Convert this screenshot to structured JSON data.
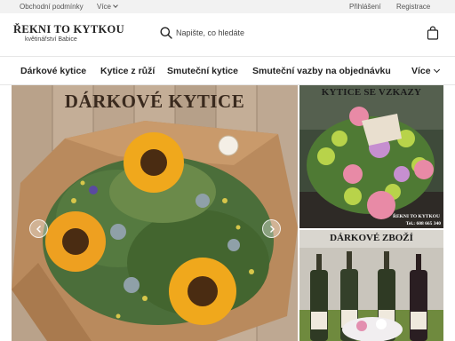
{
  "topbar": {
    "terms_label": "Obchodní podmínky",
    "more_label": "Více",
    "login_label": "Přihlášení",
    "register_label": "Registrace"
  },
  "header": {
    "logo_title": "ŘEKNI TO KYTKOU",
    "logo_subtitle": "květinářství Babice",
    "search_placeholder": "Napište, co hledáte"
  },
  "nav": {
    "items": [
      {
        "label": "Dárkové kytice"
      },
      {
        "label": "Kytice z růží"
      },
      {
        "label": "Smuteční kytice"
      },
      {
        "label": "Smuteční vazby na objednávku"
      }
    ],
    "more_label": "Více"
  },
  "banner": {
    "title": "DÁRKOVÉ KYTICE"
  },
  "side_banners": {
    "first": {
      "title": "KYTICE SE VZKAZY",
      "shop_name": "ŘEKNI TO KYTKOU",
      "phone": "Tel.: 608 665 340"
    },
    "second": {
      "title": "DÁRKOVÉ ZBOŽÍ"
    }
  },
  "colors": {
    "topbar_bg": "#f2f2f2",
    "wood": "#bfa992",
    "kraft_paper": "#b98a5d",
    "sunflower": "#f0a81c"
  }
}
